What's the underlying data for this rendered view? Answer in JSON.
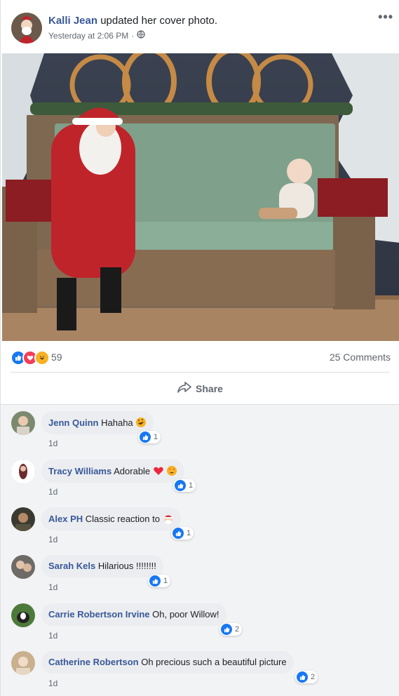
{
  "post": {
    "author": "Kalli Jean",
    "action": "updated her cover photo.",
    "timestamp": "Yesterday at 2:06 PM",
    "separator": "·",
    "privacy_icon": "globe-icon",
    "more_label": "•••"
  },
  "stats": {
    "reaction_icons": [
      "like-icon",
      "love-icon",
      "haha-icon"
    ],
    "reaction_count": "59",
    "comments_label": "25 Comments"
  },
  "share": {
    "label": "Share",
    "icon": "share-arrow-icon"
  },
  "colors": {
    "accent": "#385898",
    "like_blue": "#1877f2",
    "love_red": "#f33e58",
    "haha_yellow": "#f7b125"
  },
  "comments": [
    {
      "name": "Jenn Quinn",
      "text": "Hahaha",
      "emoji": "rofl-emoji",
      "likes": "1",
      "time": "1d"
    },
    {
      "name": "Tracy Williams",
      "text": "Adorable",
      "emoji": "heart-heart-eyes-emoji",
      "likes": "1",
      "time": "1d"
    },
    {
      "name": "Alex PH",
      "text": "Classic reaction to",
      "emoji": "santa-emoji",
      "likes": "1",
      "time": "1d"
    },
    {
      "name": "Sarah Kels",
      "text": "Hilarious !!!!!!!!",
      "emoji": "",
      "likes": "1",
      "time": "1d"
    },
    {
      "name": "Carrie Robertson Irvine",
      "text": "Oh, poor Willow!",
      "emoji": "",
      "likes": "2",
      "time": "1d"
    },
    {
      "name": "Catherine Robertson",
      "text": "Oh precious such a beautiful picture",
      "emoji": "",
      "likes": "2",
      "time": "1d"
    }
  ]
}
